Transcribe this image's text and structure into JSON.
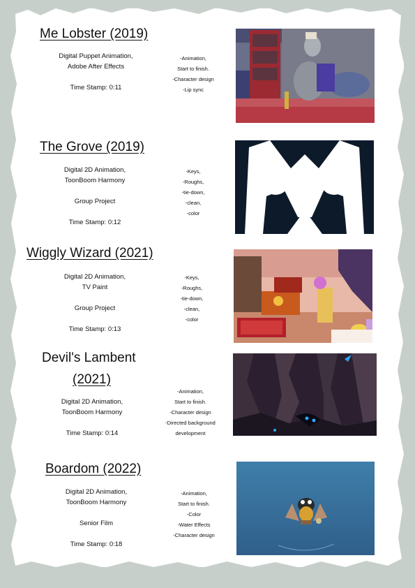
{
  "entries": [
    {
      "title": "Me Lobster (2019)",
      "details": [
        "Digital Puppet Animation,",
        "Adobe After Effects",
        "",
        "Time Stamp: 0:11"
      ],
      "roles": [
        "-Animation,",
        "Start to finish.",
        "-Character design",
        "-Lip sync"
      ],
      "thumbnail_icon": "lobster-pirate-scene"
    },
    {
      "title": "The Grove (2019)",
      "details": [
        "Digital 2D Animation,",
        "ToonBoom Harmony",
        "",
        "Group Project",
        "",
        "Time Stamp: 0:12"
      ],
      "roles": [
        "-Keys,",
        "-Roughs,",
        "-tie-down,",
        "-clean,",
        "-color"
      ],
      "thumbnail_icon": "mask-face-scene"
    },
    {
      "title": "Wiggly Wizard (2021)",
      "details": [
        "Digital 2D Animation,",
        "TV Paint",
        "",
        "Group Project",
        "",
        "Time Stamp: 0:13"
      ],
      "roles": [
        "-Keys,",
        "-Roughs,",
        "-tie-down,",
        "-clean,",
        "-color"
      ],
      "thumbnail_icon": "wizard-room-scene"
    },
    {
      "title_line1": "Devil's Lambent",
      "title_line2": "(2021)",
      "details": [
        "Digital 2D Animation,",
        "ToonBoom Harmony",
        "",
        "Time Stamp: 0:14"
      ],
      "roles": [
        "-Animation,",
        "Start to finish.",
        "-Character design",
        "-Directed background",
        "development"
      ],
      "thumbnail_icon": "cave-creature-scene"
    },
    {
      "title": "Boardom (2022)",
      "details": [
        "Digital 2D Animation,",
        "ToonBoom Harmony",
        "",
        "Senior Film",
        "",
        "Time Stamp: 0:18"
      ],
      "roles": [
        "-Animation,",
        "Start to finish.",
        "-Color",
        "-Water Effects",
        "-Character design"
      ],
      "thumbnail_icon": "underwater-diver-scene"
    }
  ],
  "colors": {
    "page_bg": "#c7cfca",
    "paper": "#ffffff",
    "text": "#111111"
  }
}
